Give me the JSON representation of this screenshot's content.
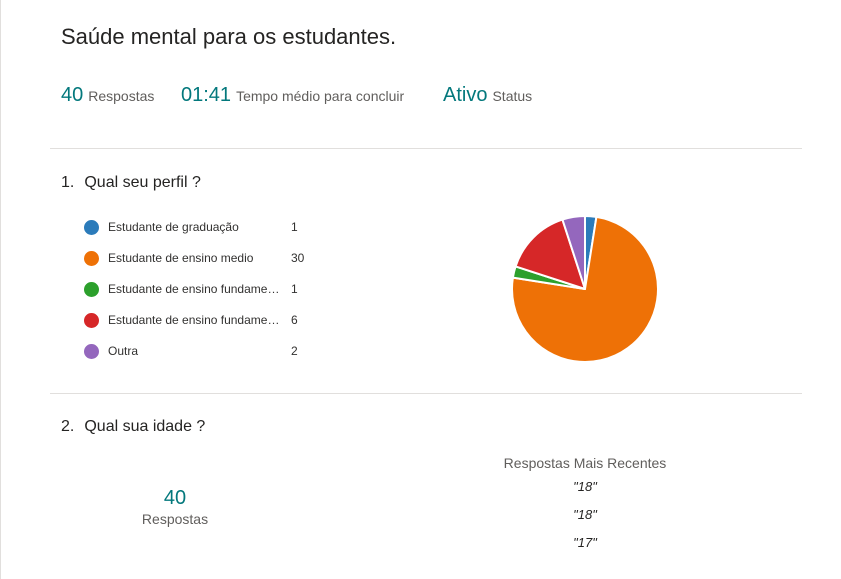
{
  "form": {
    "title": "Saúde mental para os estudantes."
  },
  "summary": {
    "responses": {
      "value": "40",
      "label": "Respostas"
    },
    "avg_time": {
      "value": "01:41",
      "label": "Tempo médio para concluir"
    },
    "status": {
      "value": "Ativo",
      "label": "Status"
    }
  },
  "q1": {
    "number": "1.",
    "title": "Qual seu perfil ?",
    "options": [
      {
        "label": "Estudante de graduação",
        "count": "1",
        "color": "#2b7bba"
      },
      {
        "label": "Estudante de ensino medio",
        "count": "30",
        "color": "#ee7106"
      },
      {
        "label": "Estudante de ensino fundamental...",
        "count": "1",
        "color": "#2ca02c"
      },
      {
        "label": "Estudante de ensino fundamental...",
        "count": "6",
        "color": "#d62728"
      },
      {
        "label": "Outra",
        "count": "2",
        "color": "#9467bd"
      }
    ]
  },
  "q2": {
    "number": "2.",
    "title": "Qual sua idade ?",
    "responses_value": "40",
    "responses_label": "Respostas",
    "recent_title": "Respostas Mais Recentes",
    "recent": [
      "\"18\"",
      "\"18\"",
      "\"17\""
    ]
  },
  "colors": {
    "accent": "#03787c",
    "divider": "#e1dfdd"
  }
}
